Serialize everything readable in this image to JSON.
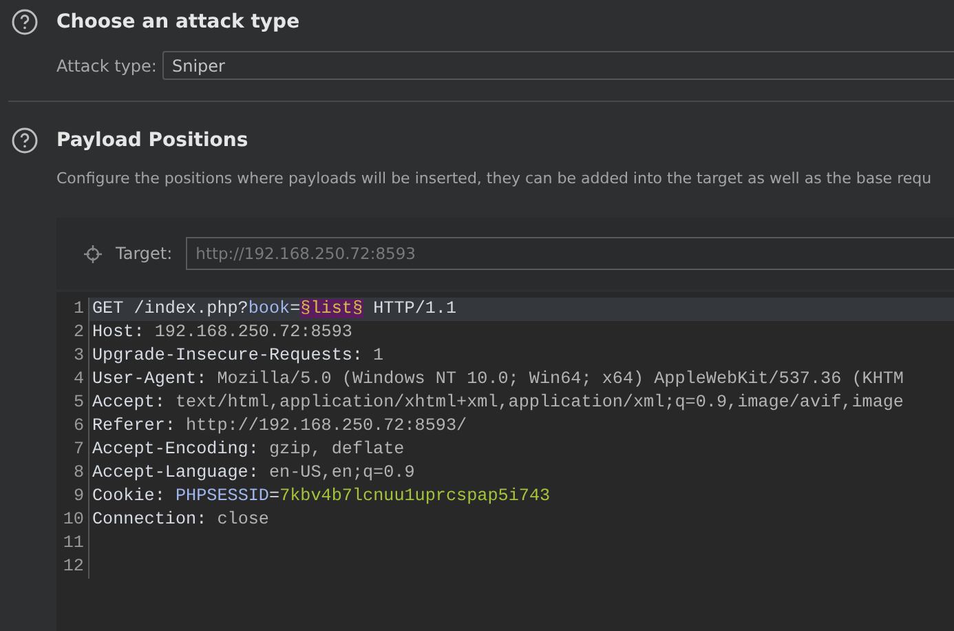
{
  "attack_section": {
    "title": "Choose an attack type",
    "field_label": "Attack type:",
    "value": "Sniper"
  },
  "positions_section": {
    "title": "Payload Positions",
    "description": "Configure the positions where payloads will be inserted, they can be added into the target as well as the base requ"
  },
  "target": {
    "label": "Target:",
    "placeholder": "http://192.168.250.72:8593"
  },
  "editor": {
    "lines": [
      {
        "number": "1",
        "selected": true,
        "segments": [
          {
            "kind": "key",
            "text": "GET /index.php?"
          },
          {
            "kind": "param",
            "text": "book"
          },
          {
            "kind": "key",
            "text": "="
          },
          {
            "kind": "payload",
            "text": "§list§"
          },
          {
            "kind": "key",
            "text": " HTTP/1.1"
          }
        ]
      },
      {
        "number": "2",
        "selected": false,
        "segments": [
          {
            "kind": "key",
            "text": "Host:"
          },
          {
            "kind": "value",
            "text": " 192.168.250.72:8593"
          }
        ]
      },
      {
        "number": "3",
        "selected": false,
        "segments": [
          {
            "kind": "key",
            "text": "Upgrade-Insecure-Requests:"
          },
          {
            "kind": "value",
            "text": " 1"
          }
        ]
      },
      {
        "number": "4",
        "selected": false,
        "segments": [
          {
            "kind": "key",
            "text": "User-Agent:"
          },
          {
            "kind": "value",
            "text": " Mozilla/5.0 (Windows NT 10.0; Win64; x64) AppleWebKit/537.36 (KHTM"
          }
        ]
      },
      {
        "number": "5",
        "selected": false,
        "segments": [
          {
            "kind": "key",
            "text": "Accept:"
          },
          {
            "kind": "value",
            "text": " text/html,application/xhtml+xml,application/xml;q=0.9,image/avif,image"
          }
        ]
      },
      {
        "number": "6",
        "selected": false,
        "segments": [
          {
            "kind": "key",
            "text": "Referer:"
          },
          {
            "kind": "value",
            "text": " http://192.168.250.72:8593/"
          }
        ]
      },
      {
        "number": "7",
        "selected": false,
        "segments": [
          {
            "kind": "key",
            "text": "Accept-Encoding:"
          },
          {
            "kind": "value",
            "text": " gzip, deflate"
          }
        ]
      },
      {
        "number": "8",
        "selected": false,
        "segments": [
          {
            "kind": "key",
            "text": "Accept-Language:"
          },
          {
            "kind": "value",
            "text": " en-US,en;q=0.9"
          }
        ]
      },
      {
        "number": "9",
        "selected": false,
        "segments": [
          {
            "kind": "key",
            "text": "Cookie: "
          },
          {
            "kind": "param",
            "text": "PHPSESSID"
          },
          {
            "kind": "key",
            "text": "="
          },
          {
            "kind": "cookie",
            "text": "7kbv4b7lcnuu1uprcspap5i743"
          }
        ]
      },
      {
        "number": "10",
        "selected": false,
        "segments": [
          {
            "kind": "key",
            "text": "Connection:"
          },
          {
            "kind": "value",
            "text": " close"
          }
        ]
      },
      {
        "number": "11",
        "selected": false
      },
      {
        "number": "12",
        "selected": false
      }
    ]
  }
}
